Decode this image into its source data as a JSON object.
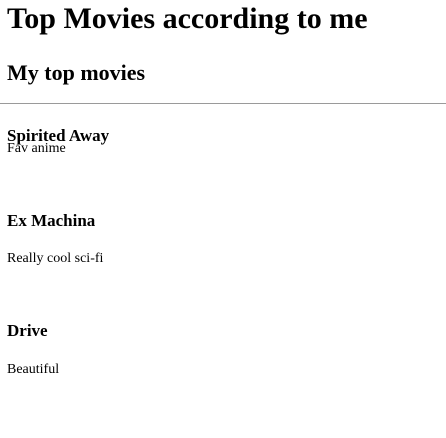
{
  "page": {
    "title": "Top Movies according to me"
  },
  "main": {
    "heading": "My top movies",
    "movies": [
      {
        "title": "Spirited Away",
        "description": "Fav anime"
      },
      {
        "title": "Ex Machina",
        "description": "Really cool sci-fi"
      },
      {
        "title": "Drive",
        "description": "Beautiful"
      }
    ]
  }
}
